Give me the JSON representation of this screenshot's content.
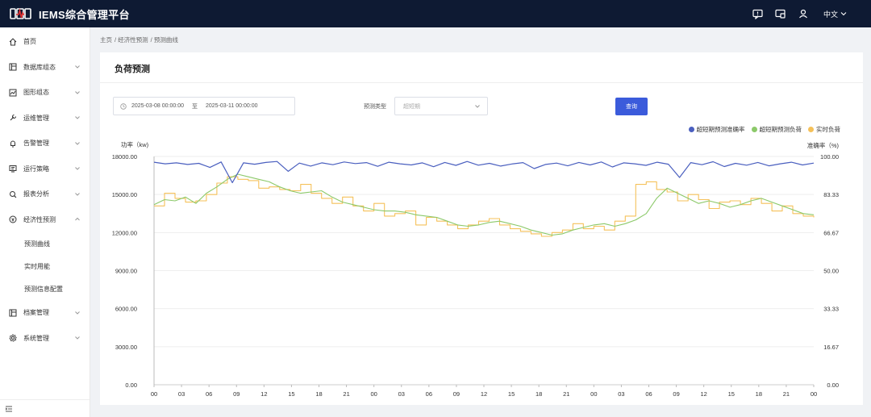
{
  "app": {
    "title": "IEMS综合管理平台",
    "logo_text": "GWU"
  },
  "header": {
    "language": "中文",
    "icons": [
      "message-icon",
      "screen-icon",
      "user-icon"
    ]
  },
  "sidebar": {
    "items": [
      {
        "label": "首页",
        "icon": "home-icon",
        "expandable": false
      },
      {
        "label": "数据库组态",
        "icon": "database-icon",
        "expandable": true
      },
      {
        "label": "图形组态",
        "icon": "graph-icon",
        "expandable": true
      },
      {
        "label": "运维管理",
        "icon": "wrench-icon",
        "expandable": true
      },
      {
        "label": "告警管理",
        "icon": "bell-icon",
        "expandable": true
      },
      {
        "label": "运行策略",
        "icon": "strategy-icon",
        "expandable": true
      },
      {
        "label": "报表分析",
        "icon": "report-icon",
        "expandable": true
      },
      {
        "label": "经济性预测",
        "icon": "forecast-icon",
        "expandable": true,
        "expanded": true
      }
    ],
    "sub_items": [
      "预测曲线",
      "实时用能",
      "预测信息配置"
    ],
    "items_after": [
      {
        "label": "档案管理",
        "icon": "archive-icon",
        "expandable": true
      },
      {
        "label": "系统管理",
        "icon": "settings-icon",
        "expandable": true
      }
    ]
  },
  "breadcrumb": [
    "主页",
    "/ 经济性预测",
    "/ 预测曲线"
  ],
  "page": {
    "title": "负荷预测",
    "date_start": "2025-03-08 00:00:00",
    "date_sep": "至",
    "date_end": "2025-03-11 00:00:00",
    "type_label": "预测类型",
    "type_placeholder": "超短期",
    "query_label": "查询"
  },
  "colors": {
    "accuracy": "#4a5fbf",
    "forecast": "#8cc96a",
    "actual": "#f5c15a",
    "accent": "#3b5bdb",
    "header": "#0e1a33"
  },
  "chart_data": {
    "type": "line",
    "ylabel": "功率（kw)",
    "y2label": "准确率（%)",
    "ylim": [
      0,
      18000
    ],
    "y2lim": [
      0,
      100
    ],
    "yticks": [
      "0.00",
      "3000.00",
      "6000.00",
      "9000.00",
      "12000.00",
      "15000.00",
      "18000.00"
    ],
    "y2ticks": [
      "0.00",
      "16.67",
      "33.33",
      "50.00",
      "66.67",
      "83.33",
      "100.00"
    ],
    "xticks": [
      "00",
      "03",
      "06",
      "09",
      "12",
      "15",
      "18",
      "21",
      "00",
      "03",
      "06",
      "09",
      "12",
      "15",
      "18",
      "21",
      "00",
      "03",
      "06",
      "09",
      "12",
      "15",
      "18",
      "21",
      "00"
    ],
    "legend_position": "top-right",
    "series": [
      {
        "name": "超短期预测准确率",
        "axis": "right",
        "color": "#4a5fbf",
        "values": [
          97.5,
          96.8,
          97.2,
          96.5,
          97,
          95.2,
          97.6,
          88.5,
          97.2,
          96.6,
          97.4,
          97.8,
          93.5,
          97.1,
          95.8,
          97.2,
          96.4,
          97.6,
          96.9,
          97.3,
          95.7,
          97.5,
          96.8,
          96.3,
          97.2,
          95.5,
          97.4,
          96.1,
          97.8,
          96.2,
          97,
          95.8,
          96.7,
          97.3,
          94.7,
          96.5,
          97.1,
          95.9,
          97.4,
          96.3,
          97.6,
          95.4,
          97.2,
          96.8,
          96.1,
          97.5,
          96.6,
          90.8,
          97.3,
          96.4,
          97.7,
          95.6,
          97,
          96.2,
          97.4,
          95.9,
          96.8,
          97.5,
          96.3,
          97.1
        ]
      },
      {
        "name": "超短期预测负荷",
        "axis": "left",
        "color": "#8cc96a",
        "values": [
          14200,
          14600,
          14500,
          14800,
          14300,
          15100,
          15600,
          16200,
          16600,
          16400,
          16200,
          16000,
          15600,
          15300,
          15100,
          15200,
          15300,
          14800,
          14400,
          14200,
          14000,
          13800,
          13700,
          13700,
          13600,
          13400,
          13300,
          13200,
          12900,
          12600,
          12500,
          12600,
          12800,
          12900,
          12700,
          12500,
          12200,
          12000,
          11800,
          11900,
          12200,
          12400,
          12600,
          12700,
          12500,
          12700,
          13000,
          13500,
          14700,
          15500,
          15100,
          14700,
          14300,
          14500,
          14300,
          14000,
          14200,
          14500,
          14700,
          14400,
          14100,
          13800,
          13500,
          13400
        ]
      },
      {
        "name": "实时负荷",
        "axis": "left",
        "color": "#f5c15a",
        "values": [
          14100,
          15100,
          14700,
          14400,
          14500,
          15000,
          15900,
          16400,
          16200,
          16100,
          15500,
          15600,
          15400,
          15300,
          15800,
          15100,
          14700,
          14300,
          14800,
          14100,
          13700,
          14300,
          13300,
          13500,
          13700,
          12600,
          13200,
          12900,
          12600,
          12300,
          12600,
          12900,
          13100,
          12600,
          12300,
          12100,
          11900,
          11700,
          12000,
          12200,
          12700,
          12300,
          12500,
          12200,
          12900,
          13300,
          15800,
          16000,
          15400,
          15200,
          14500,
          15000,
          14600,
          13900,
          14400,
          14500,
          14200,
          14700,
          14300,
          13700,
          14100,
          13500,
          13300,
          13200
        ]
      }
    ]
  }
}
